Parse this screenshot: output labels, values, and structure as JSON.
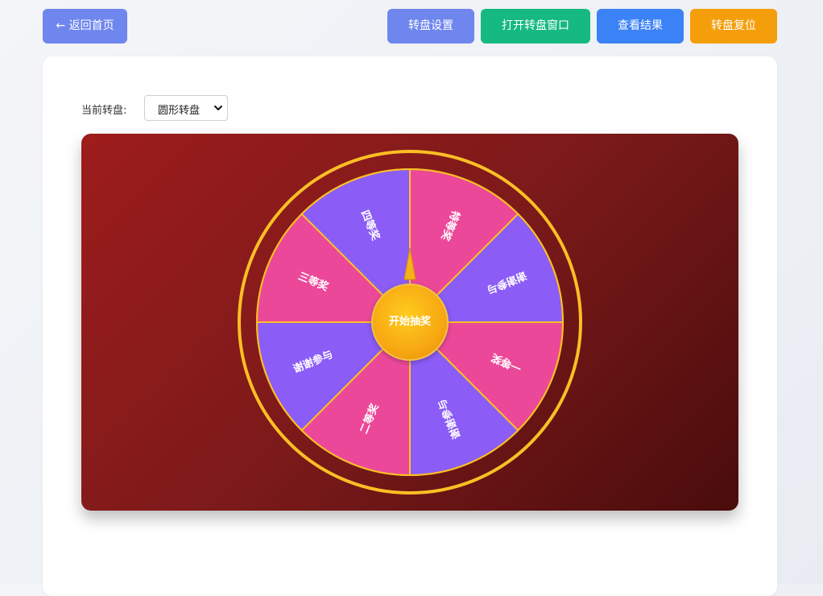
{
  "toolbar": {
    "back_label": "← 返回首页",
    "settings_label": "转盘设置",
    "open_window_label": "打开转盘窗口",
    "results_label": "查看结果",
    "reset_label": "转盘复位"
  },
  "selector": {
    "label": "当前转盘:",
    "value": "圆形转盘"
  },
  "wheel": {
    "start_label": "开始抽奖",
    "segments": [
      {
        "label": "特等奖",
        "color": "#ec4899"
      },
      {
        "label": "谢谢参与",
        "color": "#8b5cf6"
      },
      {
        "label": "一等奖",
        "color": "#ec4899"
      },
      {
        "label": "谢谢参与",
        "color": "#8b5cf6"
      },
      {
        "label": "二等奖",
        "color": "#ec4899"
      },
      {
        "label": "谢谢参与",
        "color": "#8b5cf6"
      },
      {
        "label": "三等奖",
        "color": "#ec4899"
      },
      {
        "label": "四等奖",
        "color": "#8b5cf6"
      }
    ],
    "ring_color": "#fbbf24",
    "pointer_color": "#f5b11a"
  }
}
